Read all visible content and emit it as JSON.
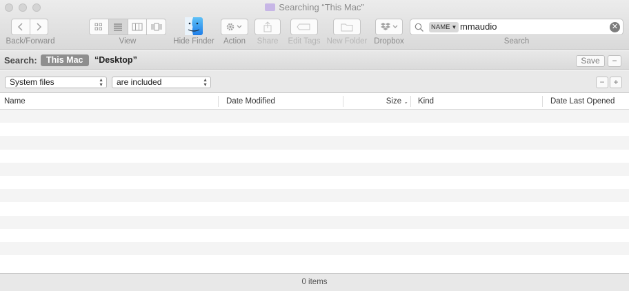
{
  "window": {
    "title": "Searching “This Mac”",
    "folder_color": "#c7b6e6"
  },
  "toolbar": {
    "back_forward_label": "Back/Forward",
    "view_label": "View",
    "hide_finder_label": "Hide Finder",
    "action_label": "Action",
    "share_label": "Share",
    "edit_tags_label": "Edit Tags",
    "new_folder_label": "New Folder",
    "dropbox_label": "Dropbox",
    "search_label": "Search",
    "active_view": "list"
  },
  "search": {
    "token": "NAME",
    "query": "mmaudio"
  },
  "search_bar": {
    "label": "Search:",
    "scope_active": "This Mac",
    "scope_other": "“Desktop”",
    "save_label": "Save",
    "minus_label": "−"
  },
  "criteria": {
    "attribute": "System files",
    "condition": "are included",
    "remove_label": "−",
    "add_label": "+"
  },
  "columns": {
    "name": "Name",
    "date_modified": "Date Modified",
    "size": "Size",
    "kind": "Kind",
    "date_last_opened": "Date Last Opened",
    "sorted_by": "Size"
  },
  "status": {
    "items_text": "0 items"
  },
  "colors": {
    "scope_active_bg": "#8e8e8e",
    "row_alt": "#f4f4f4"
  }
}
